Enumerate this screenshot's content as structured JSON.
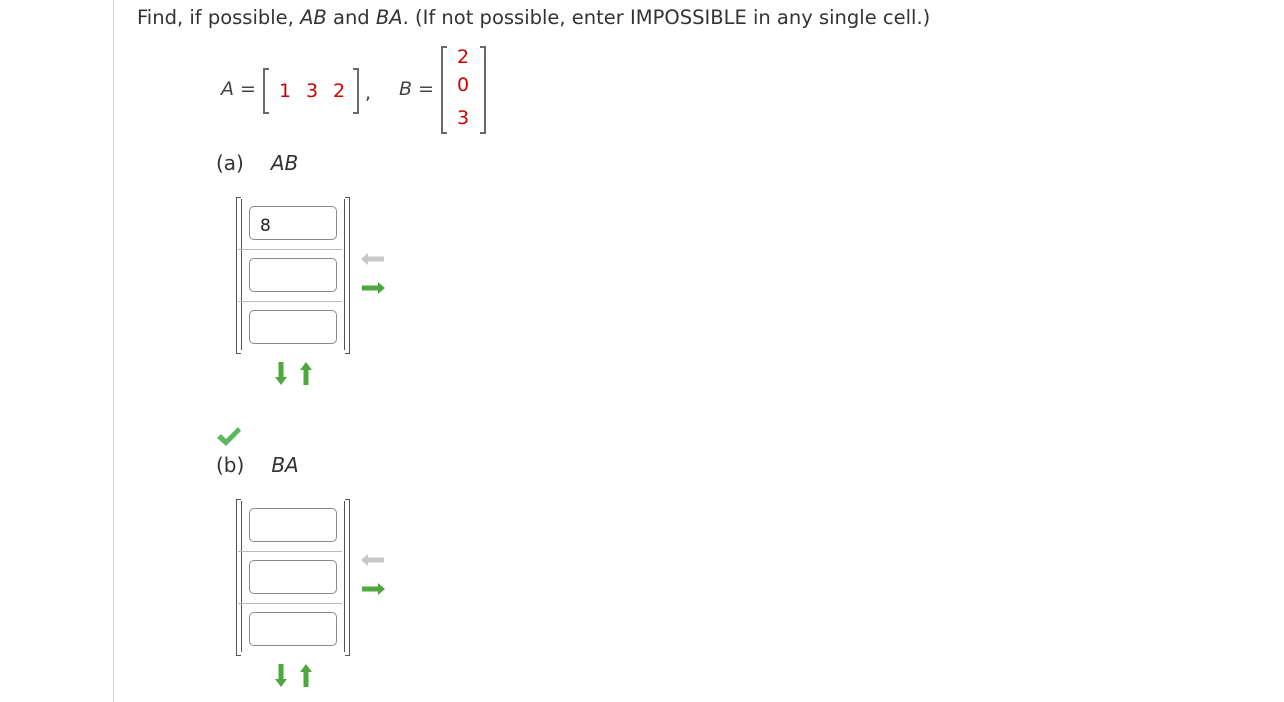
{
  "question": {
    "prefix": "Find, if possible, ",
    "ab": "AB",
    "and": " and ",
    "ba": "BA",
    "suffix": ". (If not possible, enter IMPOSSIBLE in any single cell.)"
  },
  "given": {
    "a_label": "A",
    "b_label": "B",
    "equals": "=",
    "comma": ",",
    "a_values": [
      "1",
      "3",
      "2"
    ],
    "b_values": [
      "2",
      "0",
      "3"
    ]
  },
  "part_a": {
    "label": "(a)",
    "expr": "AB",
    "cells": [
      "8",
      "",
      ""
    ],
    "status_icon": "checkmark-icon"
  },
  "part_b": {
    "label": "(b)",
    "expr": "BA",
    "cells": [
      "",
      "",
      ""
    ]
  },
  "icons": {
    "arrow_left": "arrow-left-icon",
    "arrow_right": "arrow-right-icon",
    "arrow_down": "arrow-down-icon",
    "arrow_up": "arrow-up-icon"
  },
  "colors": {
    "given_values": "#d40000",
    "arrow_green": "#4ea83f",
    "arrow_disabled": "#c8c8c8",
    "check_green": "#5cb85c"
  }
}
